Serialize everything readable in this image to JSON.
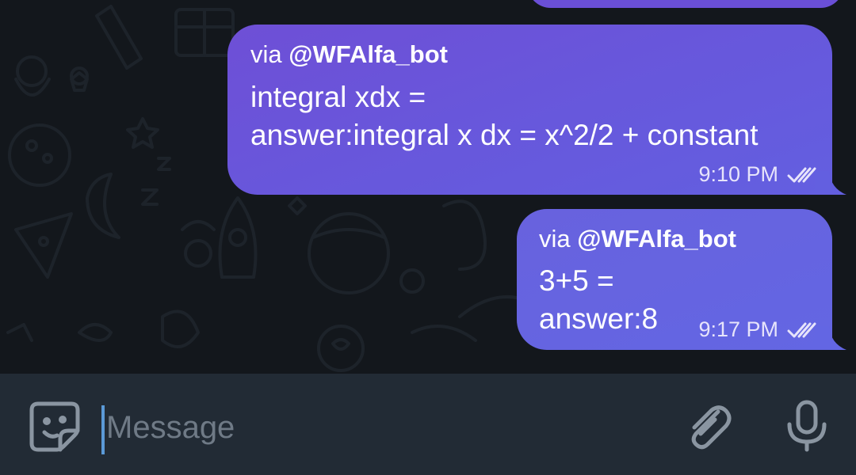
{
  "messages": [
    {
      "via_prefix": "via ",
      "via_bot": "@WFAlfa_bot",
      "lines": [
        "integral xdx =",
        "answer:integral x dx = x^2/2 + constant"
      ],
      "time": "9:10 PM",
      "status": "read"
    },
    {
      "via_prefix": "via ",
      "via_bot": "@WFAlfa_bot",
      "lines": [
        "3+5 =",
        "answer:8"
      ],
      "time": "9:17 PM",
      "status": "read"
    }
  ],
  "composer": {
    "placeholder": "Message",
    "value": ""
  },
  "icons": {
    "sticker": "sticker-icon",
    "attach": "paperclip-icon",
    "mic": "microphone-icon",
    "read": "double-check-icon"
  },
  "colors": {
    "bubble_outgoing": "#6a5ad9",
    "chat_background": "#13171c",
    "composer_background": "#222b35",
    "caret": "#5b9ad7"
  }
}
